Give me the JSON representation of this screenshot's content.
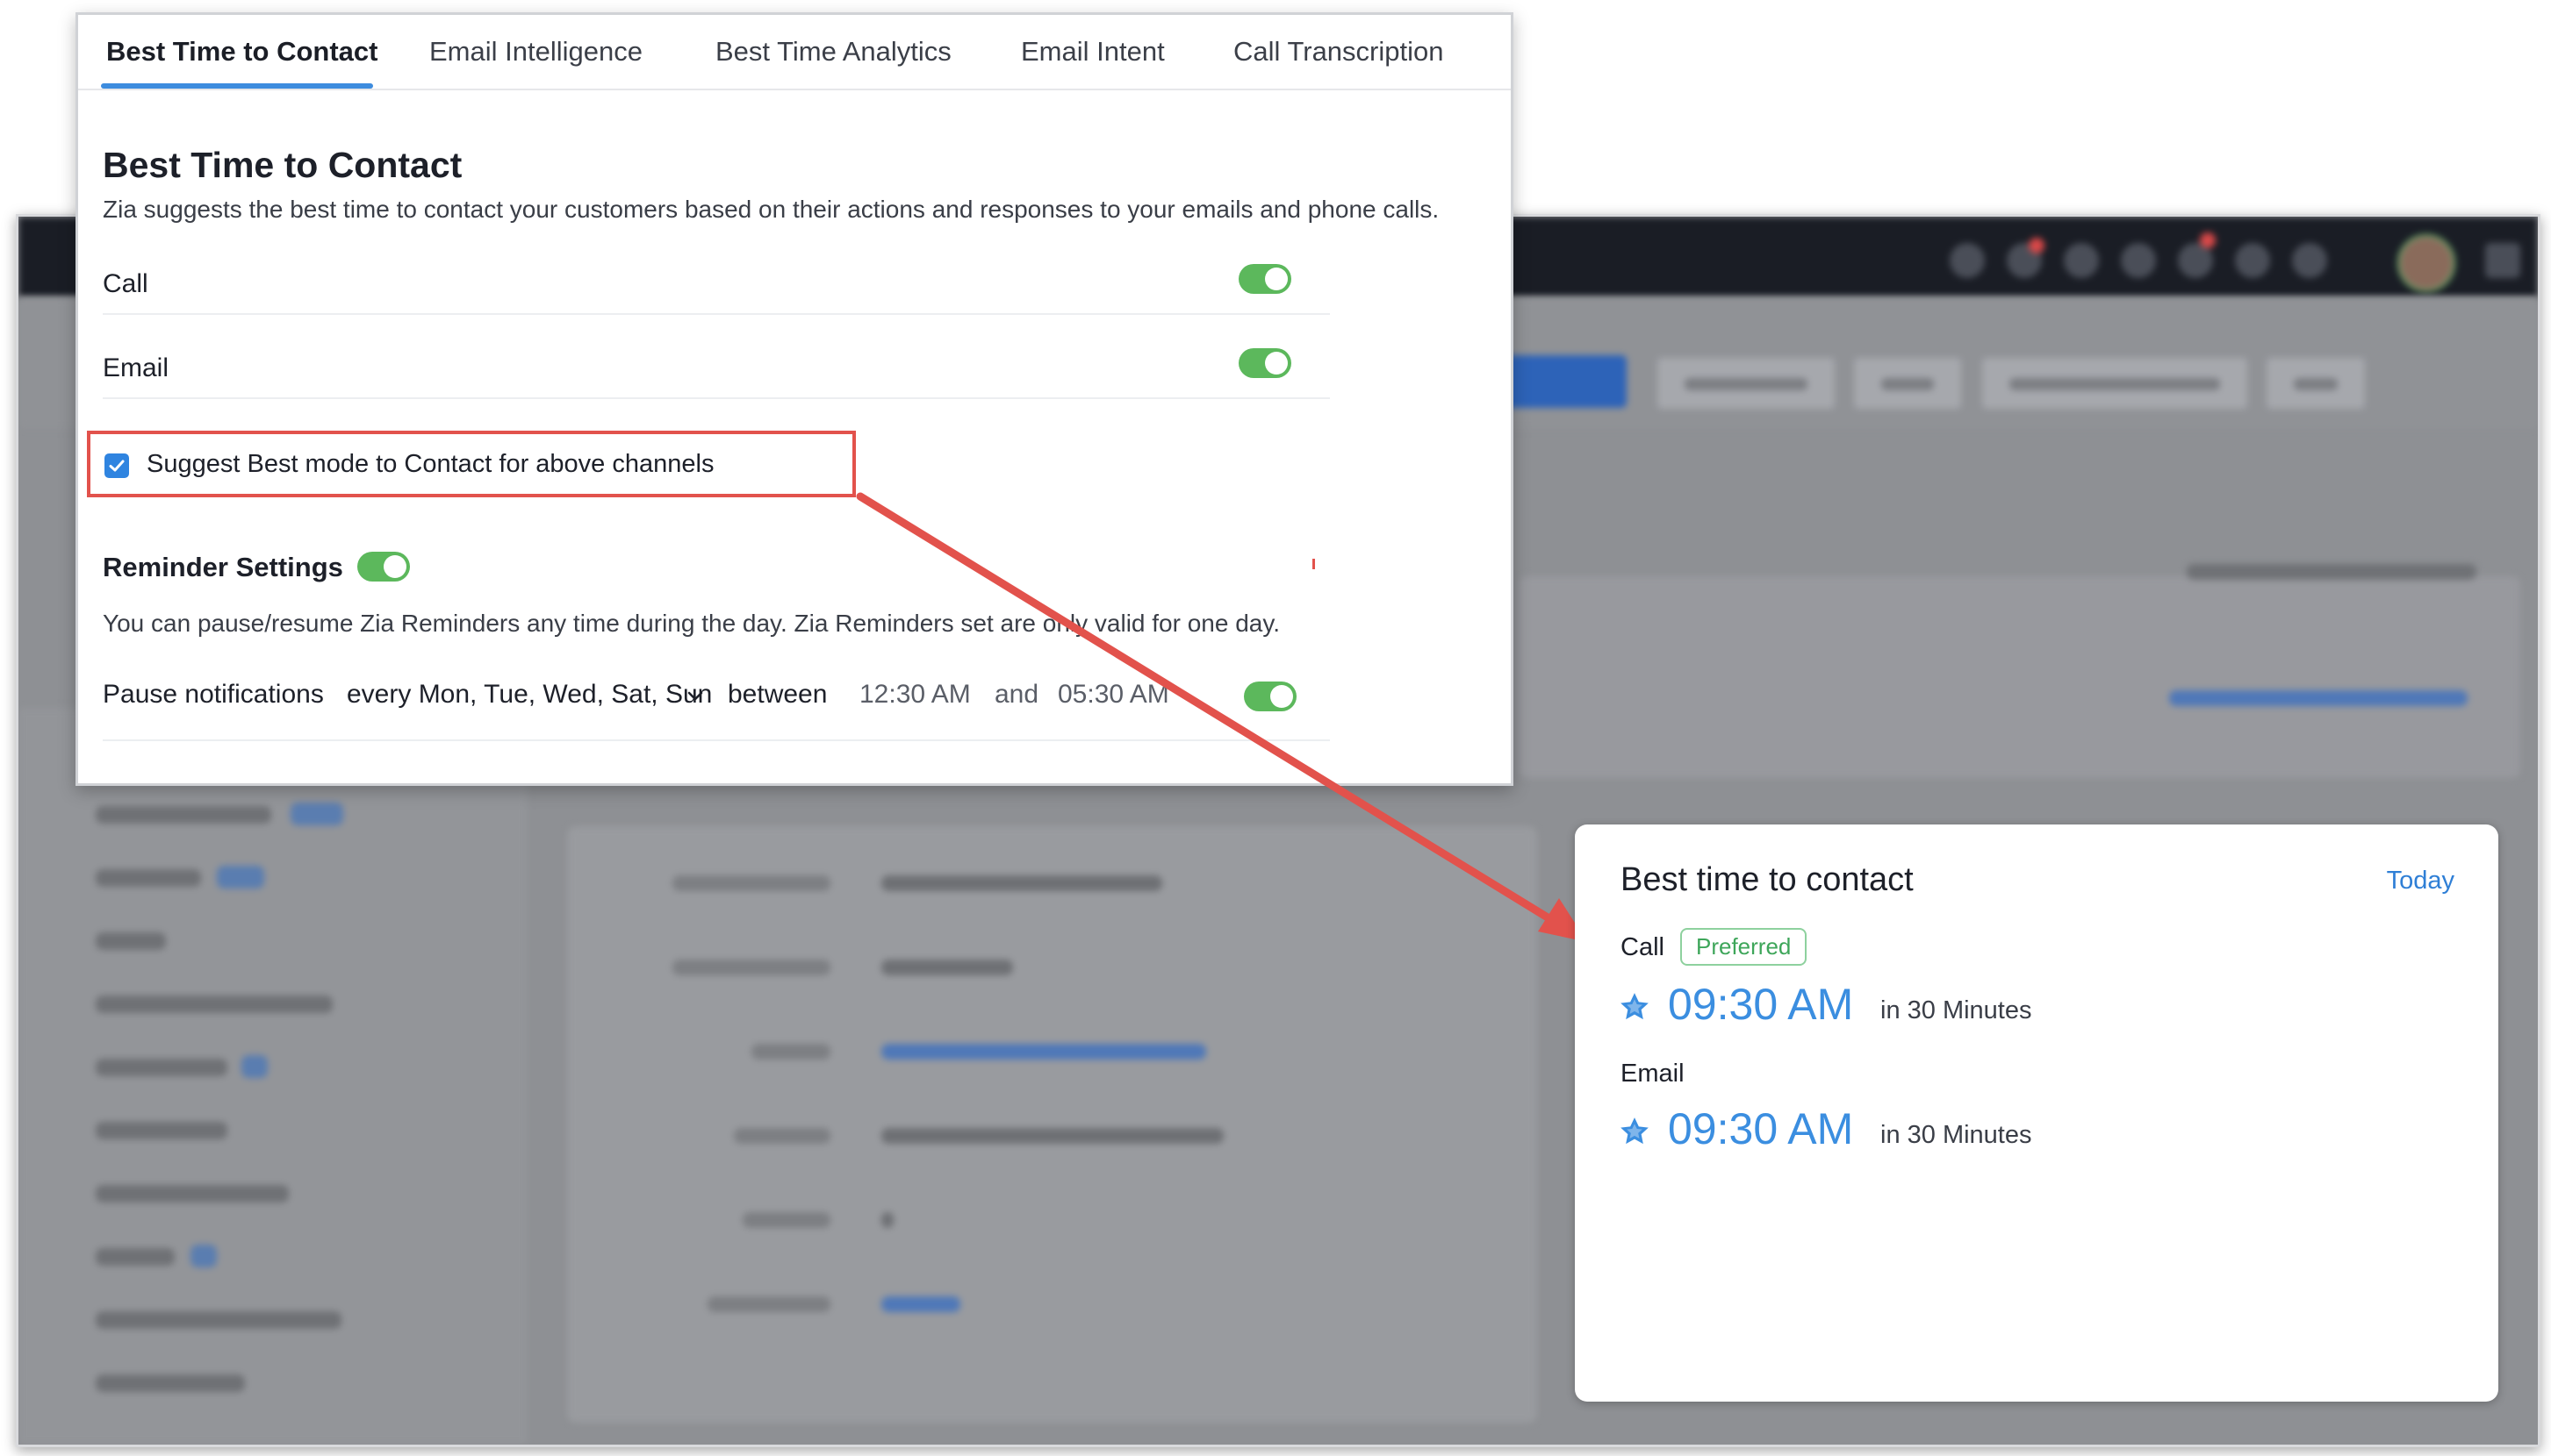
{
  "tabs": [
    {
      "label": "Best Time to Contact",
      "active": true
    },
    {
      "label": "Email Intelligence",
      "active": false
    },
    {
      "label": "Best Time Analytics",
      "active": false
    },
    {
      "label": "Email Intent",
      "active": false
    },
    {
      "label": "Call Transcription",
      "active": false
    }
  ],
  "settings": {
    "title": "Best Time to Contact",
    "subtitle": "Zia suggests the best time to contact your customers based on their actions and responses to your emails and phone calls.",
    "channels": [
      {
        "label": "Call",
        "enabled": true
      },
      {
        "label": "Email",
        "enabled": true
      }
    ],
    "suggest_checkbox": {
      "label": "Suggest Best mode to Contact for above channels",
      "checked": true
    }
  },
  "reminder": {
    "title": "Reminder Settings",
    "enabled": true,
    "description": "You can pause/resume Zia Reminders any time during the day. Zia Reminders set are only valid for one day.",
    "pause_label": "Pause notifications",
    "days": "every Mon, Tue, Wed, Sat, Sun",
    "between_label": "between",
    "start_time": "12:30 AM",
    "and_label": "and",
    "end_time": "05:30 AM",
    "pause_enabled": true
  },
  "best_time_card": {
    "title": "Best time to contact",
    "period": "Today",
    "entries": [
      {
        "channel": "Call",
        "badge": "Preferred",
        "time": "09:30 AM",
        "relative": "in 30 Minutes"
      },
      {
        "channel": "Email",
        "badge": "",
        "time": "09:30 AM",
        "relative": "in 30 Minutes"
      }
    ]
  },
  "colors": {
    "accent_blue": "#2f84e0",
    "toggle_green": "#5cb85c",
    "highlight_red": "#e2524c",
    "preferred_green": "#3ea65a"
  },
  "icons": [
    "checkmark-icon",
    "chevron-down-icon",
    "star-icon",
    "arrow-annotation"
  ]
}
